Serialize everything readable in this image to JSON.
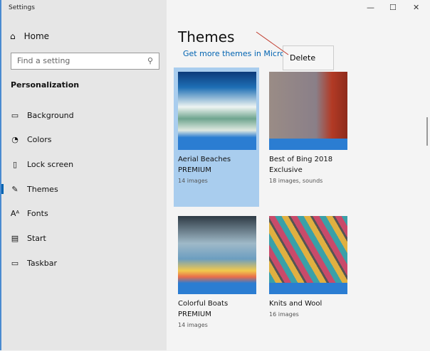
{
  "window": {
    "title": "Settings",
    "controls": [
      "—",
      "☐",
      "✕"
    ]
  },
  "sidebar": {
    "home": "Home",
    "search_placeholder": "Find a setting",
    "section": "Personalization",
    "items": [
      {
        "label": "Background",
        "icon": "picture-icon",
        "glyph": "▭"
      },
      {
        "label": "Colors",
        "icon": "palette-icon",
        "glyph": "◔"
      },
      {
        "label": "Lock screen",
        "icon": "lock-screen-icon",
        "glyph": "▯"
      },
      {
        "label": "Themes",
        "icon": "themes-icon",
        "glyph": "✎"
      },
      {
        "label": "Fonts",
        "icon": "fonts-icon",
        "glyph": "Aᴬ"
      },
      {
        "label": "Start",
        "icon": "start-icon",
        "glyph": "▤"
      },
      {
        "label": "Taskbar",
        "icon": "taskbar-icon",
        "glyph": "▭"
      }
    ],
    "selected": "Themes"
  },
  "main": {
    "title": "Themes",
    "store_link": "Get more themes in Microsoft Store",
    "themes": [
      {
        "name": "Aerial Beaches PREMIUM",
        "detail": "14 images"
      },
      {
        "name": "Best of Bing 2018 Exclusive",
        "detail": "18 images, sounds"
      },
      {
        "name": "Colorful Boats PREMIUM",
        "detail": "14 images"
      },
      {
        "name": "Knits and Wool",
        "detail": "16 images"
      }
    ]
  },
  "context_menu": {
    "item": "Delete"
  }
}
